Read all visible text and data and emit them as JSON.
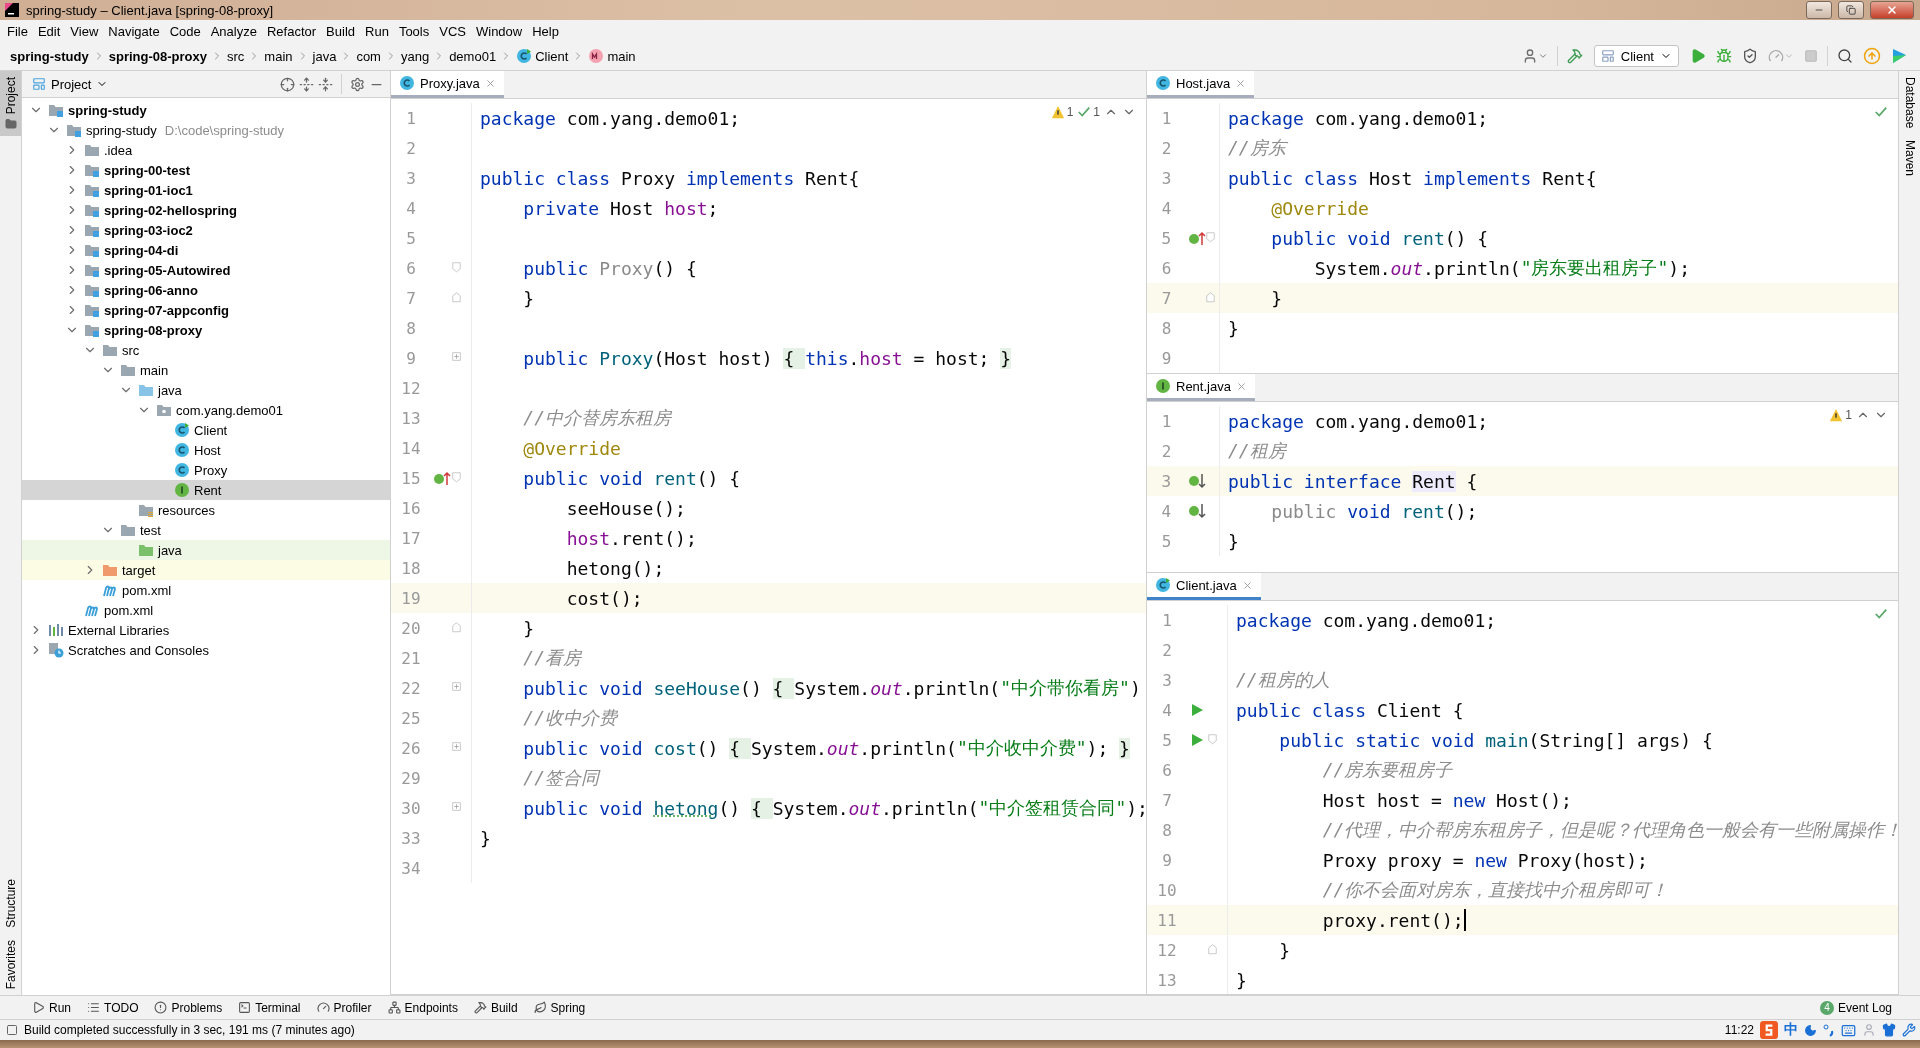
{
  "window": {
    "title": "spring-study – Client.java [spring-08-proxy]"
  },
  "menu": [
    "File",
    "Edit",
    "View",
    "Navigate",
    "Code",
    "Analyze",
    "Refactor",
    "Build",
    "Run",
    "Tools",
    "VCS",
    "Window",
    "Help"
  ],
  "breadcrumbs": [
    {
      "label": "spring-study",
      "kind": "module"
    },
    {
      "label": "spring-08-proxy",
      "kind": "module"
    },
    {
      "label": "src",
      "kind": "folder"
    },
    {
      "label": "main",
      "kind": "folder"
    },
    {
      "label": "java",
      "kind": "folder"
    },
    {
      "label": "com",
      "kind": "folder"
    },
    {
      "label": "yang",
      "kind": "folder"
    },
    {
      "label": "demo01",
      "kind": "folder"
    },
    {
      "label": "Client",
      "kind": "class"
    },
    {
      "label": "main",
      "kind": "method"
    }
  ],
  "run_config": "Client",
  "left_stripe": {
    "top": [
      {
        "label": "Project",
        "selected": true
      }
    ],
    "bottom": [
      {
        "label": "Structure",
        "selected": false
      },
      {
        "label": "Favorites",
        "selected": false
      }
    ]
  },
  "right_stripe": [
    {
      "label": "Database",
      "selected": false
    },
    {
      "label": "Maven",
      "selected": false
    }
  ],
  "project_panel": {
    "title": "Project",
    "tree": [
      {
        "label": "spring-study",
        "kind": "project",
        "expanded": true,
        "selected": false,
        "children": [
          {
            "label": "spring-study",
            "path": "D:\\code\\spring-study",
            "kind": "root",
            "expanded": true,
            "selected": false,
            "children": [
              {
                "label": ".idea",
                "kind": "folder",
                "expanded": false,
                "selected": false
              },
              {
                "label": "spring-00-test",
                "kind": "module",
                "expanded": false,
                "selected": false
              },
              {
                "label": "spring-01-ioc1",
                "kind": "module",
                "expanded": false,
                "selected": false
              },
              {
                "label": "spring-02-hellospring",
                "kind": "module",
                "expanded": false,
                "selected": false
              },
              {
                "label": "spring-03-ioc2",
                "kind": "module",
                "expanded": false,
                "selected": false
              },
              {
                "label": "spring-04-di",
                "kind": "module",
                "expanded": false,
                "selected": false
              },
              {
                "label": "spring-05-Autowired",
                "kind": "module",
                "expanded": false,
                "selected": false
              },
              {
                "label": "spring-06-anno",
                "kind": "module",
                "expanded": false,
                "selected": false
              },
              {
                "label": "spring-07-appconfig",
                "kind": "module",
                "expanded": false,
                "selected": false
              },
              {
                "label": "spring-08-proxy",
                "kind": "module",
                "expanded": true,
                "selected": false,
                "children": [
                  {
                    "label": "src",
                    "kind": "folder",
                    "expanded": true,
                    "selected": false,
                    "children": [
                      {
                        "label": "main",
                        "kind": "folder",
                        "expanded": true,
                        "selected": false,
                        "children": [
                          {
                            "label": "java",
                            "kind": "source",
                            "expanded": true,
                            "selected": false,
                            "children": [
                              {
                                "label": "com.yang.demo01",
                                "kind": "package",
                                "expanded": true,
                                "selected": false,
                                "children": [
                                  {
                                    "label": "Client",
                                    "kind": "runnable-class",
                                    "selected": false
                                  },
                                  {
                                    "label": "Host",
                                    "kind": "class",
                                    "selected": false
                                  },
                                  {
                                    "label": "Proxy",
                                    "kind": "class",
                                    "selected": false
                                  },
                                  {
                                    "label": "Rent",
                                    "kind": "interface",
                                    "selected": true
                                  }
                                ]
                              }
                            ]
                          },
                          {
                            "label": "resources",
                            "kind": "resources",
                            "selected": false
                          }
                        ]
                      },
                      {
                        "label": "test",
                        "kind": "folder",
                        "expanded": true,
                        "selected": false,
                        "children": [
                          {
                            "label": "java",
                            "kind": "test-source",
                            "selected": false
                          }
                        ]
                      }
                    ]
                  },
                  {
                    "label": "target",
                    "kind": "excluded",
                    "expanded": false,
                    "selected": false
                  },
                  {
                    "label": "pom.xml",
                    "kind": "maven",
                    "selected": false
                  }
                ]
              },
              {
                "label": "pom.xml",
                "kind": "maven",
                "selected": false
              }
            ]
          }
        ]
      },
      {
        "label": "External Libraries",
        "kind": "libraries",
        "expanded": false,
        "selected": false
      },
      {
        "label": "Scratches and Consoles",
        "kind": "scratches",
        "expanded": false,
        "selected": false
      }
    ]
  },
  "editors": [
    {
      "tab": {
        "label": "Proxy.java",
        "kind": "class",
        "selected": false
      },
      "inspections": [
        {
          "kind": "warning",
          "count": "1"
        },
        {
          "kind": "weak",
          "count": "1"
        }
      ],
      "lines": [
        {
          "no": "1",
          "current": false,
          "tokens": [
            {
              "kind": "kw",
              "text": "package"
            },
            {
              "kind": "plain",
              "text": " com.yang.demo01;"
            }
          ]
        },
        {
          "no": "2",
          "current": false
        },
        {
          "no": "3",
          "current": false,
          "tokens": [
            {
              "kind": "kw",
              "text": "public class"
            },
            {
              "kind": "plain",
              "text": " Proxy "
            },
            {
              "kind": "kw",
              "text": "implements"
            },
            {
              "kind": "plain",
              "text": " Rent{"
            }
          ]
        },
        {
          "no": "4",
          "current": false,
          "tokens": [
            {
              "kind": "kw",
              "text": "    private"
            },
            {
              "kind": "plain",
              "text": " Host "
            },
            {
              "kind": "field",
              "text": "host"
            },
            {
              "kind": "plain",
              "text": ";"
            }
          ]
        },
        {
          "no": "5",
          "current": false
        },
        {
          "no": "6",
          "current": false,
          "fold_marker": {
            "kind": "open"
          },
          "tokens": [
            {
              "kind": "kw",
              "text": "    public "
            },
            {
              "kind": "unused",
              "text": "Proxy"
            },
            {
              "kind": "plain",
              "text": "() {"
            }
          ]
        },
        {
          "no": "7",
          "current": false,
          "fold_marker": {
            "kind": "close"
          },
          "tokens": [
            {
              "kind": "plain",
              "text": "    }"
            }
          ]
        },
        {
          "no": "8",
          "current": false
        },
        {
          "no": "9",
          "current": false,
          "fold_marker": {
            "kind": "collapsed"
          },
          "tokens": [
            {
              "kind": "kw",
              "text": "    public "
            },
            {
              "kind": "method",
              "text": "Proxy"
            },
            {
              "kind": "plain",
              "text": "(Host host) "
            },
            {
              "kind": "fold",
              "text": "{ "
            },
            {
              "kind": "kw",
              "text": "this"
            },
            {
              "kind": "plain",
              "text": "."
            },
            {
              "kind": "field",
              "text": "host"
            },
            {
              "kind": "plain",
              "text": " = host; "
            },
            {
              "kind": "fold",
              "text": "}"
            }
          ]
        },
        {
          "no": "12",
          "current": false
        },
        {
          "no": "13",
          "current": false,
          "tokens": [
            {
              "kind": "comment",
              "text": "    //中介替房东租房"
            }
          ]
        },
        {
          "no": "14",
          "current": false,
          "tokens": [
            {
              "kind": "annot",
              "text": "    @Override"
            }
          ]
        },
        {
          "no": "15",
          "current": false,
          "gutter_icon": {
            "kind": "overrides"
          },
          "fold_marker": {
            "kind": "open"
          },
          "tokens": [
            {
              "kind": "kw",
              "text": "    public void "
            },
            {
              "kind": "method",
              "text": "rent"
            },
            {
              "kind": "plain",
              "text": "() {"
            }
          ]
        },
        {
          "no": "16",
          "current": false,
          "tokens": [
            {
              "kind": "plain",
              "text": "        seeHouse();"
            }
          ]
        },
        {
          "no": "17",
          "current": false,
          "tokens": [
            {
              "kind": "field",
              "text": "        host"
            },
            {
              "kind": "plain",
              "text": ".rent();"
            }
          ]
        },
        {
          "no": "18",
          "current": false,
          "tokens": [
            {
              "kind": "plain",
              "text": "        hetong();"
            }
          ]
        },
        {
          "no": "19",
          "current": true,
          "tokens": [
            {
              "kind": "plain",
              "text": "        cost();"
            }
          ]
        },
        {
          "no": "20",
          "current": false,
          "fold_marker": {
            "kind": "close"
          },
          "tokens": [
            {
              "kind": "plain",
              "text": "    }"
            }
          ]
        },
        {
          "no": "21",
          "current": false,
          "tokens": [
            {
              "kind": "comment",
              "text": "    //看房"
            }
          ]
        },
        {
          "no": "22",
          "current": false,
          "fold_marker": {
            "kind": "collapsed"
          },
          "tokens": [
            {
              "kind": "kw",
              "text": "    public void "
            },
            {
              "kind": "method",
              "text": "seeHouse"
            },
            {
              "kind": "plain",
              "text": "() "
            },
            {
              "kind": "fold",
              "text": "{ "
            },
            {
              "kind": "plain",
              "text": "System."
            },
            {
              "kind": "static",
              "text": "out"
            },
            {
              "kind": "plain",
              "text": ".println("
            },
            {
              "kind": "string",
              "text": "\"中介带你看房\""
            },
            {
              "kind": "plain",
              "text": ")"
            }
          ]
        },
        {
          "no": "25",
          "current": false,
          "tokens": [
            {
              "kind": "comment",
              "text": "    //收中介费"
            }
          ]
        },
        {
          "no": "26",
          "current": false,
          "fold_marker": {
            "kind": "collapsed"
          },
          "tokens": [
            {
              "kind": "kw",
              "text": "    public void "
            },
            {
              "kind": "method",
              "text": "cost"
            },
            {
              "kind": "plain",
              "text": "() "
            },
            {
              "kind": "fold",
              "text": "{ "
            },
            {
              "kind": "plain",
              "text": "System."
            },
            {
              "kind": "static",
              "text": "out"
            },
            {
              "kind": "plain",
              "text": ".println("
            },
            {
              "kind": "string",
              "text": "\"中介收中介费\""
            },
            {
              "kind": "plain",
              "text": "); "
            },
            {
              "kind": "fold",
              "text": "}"
            }
          ]
        },
        {
          "no": "29",
          "current": false,
          "tokens": [
            {
              "kind": "comment",
              "text": "    //签合同"
            }
          ]
        },
        {
          "no": "30",
          "current": false,
          "fold_marker": {
            "kind": "collapsed"
          },
          "tokens": [
            {
              "kind": "kw",
              "text": "    public void "
            },
            {
              "kind": "typo",
              "text": "hetong"
            },
            {
              "kind": "plain",
              "text": "() "
            },
            {
              "kind": "fold",
              "text": "{ "
            },
            {
              "kind": "plain",
              "text": "System."
            },
            {
              "kind": "static",
              "text": "out"
            },
            {
              "kind": "plain",
              "text": ".println("
            },
            {
              "kind": "string",
              "text": "\"中介签租赁合同\""
            },
            {
              "kind": "plain",
              "text": ");"
            }
          ]
        },
        {
          "no": "33",
          "current": false,
          "tokens": [
            {
              "kind": "plain",
              "text": "}"
            }
          ]
        },
        {
          "no": "34",
          "current": false
        }
      ]
    },
    {
      "tab": {
        "label": "Host.java",
        "kind": "class",
        "selected": false
      },
      "inspections": [
        {
          "kind": "ok"
        }
      ],
      "lines": [
        {
          "no": "1",
          "current": false,
          "tokens": [
            {
              "kind": "kw",
              "text": "package"
            },
            {
              "kind": "plain",
              "text": " com.yang.demo01;"
            }
          ]
        },
        {
          "no": "2",
          "current": false,
          "tokens": [
            {
              "kind": "comment",
              "text": "//房东"
            }
          ]
        },
        {
          "no": "3",
          "current": false,
          "tokens": [
            {
              "kind": "kw",
              "text": "public class"
            },
            {
              "kind": "plain",
              "text": " Host "
            },
            {
              "kind": "kw",
              "text": "implements"
            },
            {
              "kind": "plain",
              "text": " Rent{"
            }
          ]
        },
        {
          "no": "4",
          "current": false,
          "tokens": [
            {
              "kind": "annot",
              "text": "    @Override"
            }
          ]
        },
        {
          "no": "5",
          "current": false,
          "gutter_icon": {
            "kind": "overrides"
          },
          "fold_marker": {
            "kind": "open"
          },
          "tokens": [
            {
              "kind": "kw",
              "text": "    public void "
            },
            {
              "kind": "method",
              "text": "rent"
            },
            {
              "kind": "plain",
              "text": "() {"
            }
          ]
        },
        {
          "no": "6",
          "current": false,
          "tokens": [
            {
              "kind": "plain",
              "text": "        System."
            },
            {
              "kind": "static",
              "text": "out"
            },
            {
              "kind": "plain",
              "text": ".println("
            },
            {
              "kind": "string",
              "text": "\"房东要出租房子\""
            },
            {
              "kind": "plain",
              "text": ");"
            }
          ]
        },
        {
          "no": "7",
          "current": true,
          "fold_marker": {
            "kind": "close"
          },
          "tokens": [
            {
              "kind": "plain",
              "text": "    }"
            }
          ]
        },
        {
          "no": "8",
          "current": false,
          "tokens": [
            {
              "kind": "plain",
              "text": "}"
            }
          ]
        },
        {
          "no": "9",
          "current": false
        }
      ]
    },
    {
      "tab": {
        "label": "Rent.java",
        "kind": "interface",
        "selected": false
      },
      "inspections": [
        {
          "kind": "warning",
          "count": "1"
        }
      ],
      "lines": [
        {
          "no": "1",
          "current": false,
          "tokens": [
            {
              "kind": "kw",
              "text": "package"
            },
            {
              "kind": "plain",
              "text": " com.yang.demo01;"
            }
          ]
        },
        {
          "no": "2",
          "current": false,
          "tokens": [
            {
              "kind": "comment",
              "text": "//租房"
            }
          ]
        },
        {
          "no": "3",
          "current": true,
          "gutter_icon": {
            "kind": "implemented"
          },
          "tokens": [
            {
              "kind": "kw",
              "text": "public interface "
            },
            {
              "kind": "highlight",
              "text": "Rent"
            },
            {
              "kind": "plain",
              "text": " {"
            }
          ]
        },
        {
          "no": "4",
          "current": false,
          "gutter_icon": {
            "kind": "implemented"
          },
          "tokens": [
            {
              "kind": "unused",
              "text": "    public "
            },
            {
              "kind": "kw",
              "text": "void "
            },
            {
              "kind": "method",
              "text": "rent"
            },
            {
              "kind": "plain",
              "text": "();"
            }
          ]
        },
        {
          "no": "5",
          "current": false,
          "tokens": [
            {
              "kind": "plain",
              "text": "}"
            }
          ]
        }
      ]
    },
    {
      "tab": {
        "label": "Client.java",
        "kind": "runnable-class",
        "selected": true
      },
      "inspections": [
        {
          "kind": "ok"
        }
      ],
      "lines": [
        {
          "no": "1",
          "current": false,
          "tokens": [
            {
              "kind": "kw",
              "text": "package"
            },
            {
              "kind": "plain",
              "text": " com.yang.demo01;"
            }
          ]
        },
        {
          "no": "2",
          "current": false
        },
        {
          "no": "3",
          "current": false,
          "tokens": [
            {
              "kind": "comment",
              "text": "//租房的人"
            }
          ]
        },
        {
          "no": "4",
          "current": false,
          "gutter_icon": {
            "kind": "run"
          },
          "tokens": [
            {
              "kind": "kw",
              "text": "public class"
            },
            {
              "kind": "plain",
              "text": " Client {"
            }
          ]
        },
        {
          "no": "5",
          "current": false,
          "gutter_icon": {
            "kind": "run"
          },
          "fold_marker": {
            "kind": "open"
          },
          "tokens": [
            {
              "kind": "kw",
              "text": "    public static void "
            },
            {
              "kind": "method",
              "text": "main"
            },
            {
              "kind": "plain",
              "text": "(String[] args) {"
            }
          ]
        },
        {
          "no": "6",
          "current": false,
          "tokens": [
            {
              "kind": "comment",
              "text": "        //房东要租房子"
            }
          ]
        },
        {
          "no": "7",
          "current": false,
          "tokens": [
            {
              "kind": "plain",
              "text": "        Host host = "
            },
            {
              "kind": "kw",
              "text": "new"
            },
            {
              "kind": "plain",
              "text": " Host();"
            }
          ]
        },
        {
          "no": "8",
          "current": false,
          "tokens": [
            {
              "kind": "comment",
              "text": "        //代理，中介帮房东租房子，但是呢？代理角色一般会有一些附属操作！"
            }
          ]
        },
        {
          "no": "9",
          "current": false,
          "tokens": [
            {
              "kind": "plain",
              "text": "        Proxy proxy = "
            },
            {
              "kind": "kw",
              "text": "new"
            },
            {
              "kind": "plain",
              "text": " Proxy(host);"
            }
          ]
        },
        {
          "no": "10",
          "current": false,
          "tokens": [
            {
              "kind": "comment",
              "text": "        //你不会面对房东，直接找中介租房即可！"
            }
          ]
        },
        {
          "no": "11",
          "current": true,
          "caret": true,
          "tokens": [
            {
              "kind": "plain",
              "text": "        proxy.rent();"
            }
          ]
        },
        {
          "no": "12",
          "current": false,
          "fold_marker": {
            "kind": "close"
          },
          "tokens": [
            {
              "kind": "plain",
              "text": "    }"
            }
          ]
        },
        {
          "no": "13",
          "current": false,
          "tokens": [
            {
              "kind": "plain",
              "text": "}"
            }
          ]
        }
      ]
    }
  ],
  "bottom_tools": [
    {
      "label": "Run",
      "kind": "run"
    },
    {
      "label": "TODO",
      "kind": "todo"
    },
    {
      "label": "Problems",
      "kind": "problems"
    },
    {
      "label": "Terminal",
      "kind": "terminal"
    },
    {
      "label": "Profiler",
      "kind": "profiler"
    },
    {
      "label": "Endpoints",
      "kind": "endpoints"
    },
    {
      "label": "Build",
      "kind": "build"
    },
    {
      "label": "Spring",
      "kind": "spring"
    }
  ],
  "event_log": {
    "label": "Event Log",
    "count": "4"
  },
  "status_bar": {
    "message": "Build completed successfully in 3 sec, 191 ms (7 minutes ago)",
    "time": "11:22",
    "ime_mode": "中"
  }
}
